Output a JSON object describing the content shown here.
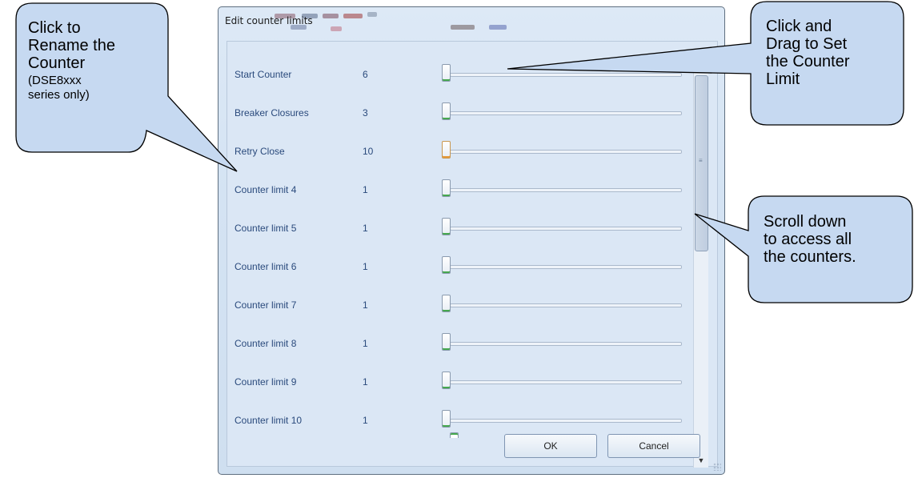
{
  "dialog": {
    "title": "Edit counter limits",
    "rows": [
      {
        "label": "Start Counter",
        "value": "6"
      },
      {
        "label": "Breaker Closures",
        "value": "3"
      },
      {
        "label": "Retry Close",
        "value": "10"
      },
      {
        "label": "Counter limit 4",
        "value": "1"
      },
      {
        "label": "Counter limit 5",
        "value": "1"
      },
      {
        "label": "Counter limit 6",
        "value": "1"
      },
      {
        "label": "Counter limit 7",
        "value": "1"
      },
      {
        "label": "Counter limit 8",
        "value": "1"
      },
      {
        "label": "Counter limit 9",
        "value": "1"
      },
      {
        "label": "Counter limit 10",
        "value": "1"
      }
    ],
    "ok_label": "OK",
    "cancel_label": "Cancel"
  },
  "callouts": {
    "rename": {
      "line1": "Click to",
      "line2": "Rename the",
      "line3": "Counter",
      "line4": "(DSE8xxx",
      "line5": "series only)"
    },
    "drag": {
      "line1": "Click and",
      "line2": "Drag to Set",
      "line3": "the Counter",
      "line4": "Limit"
    },
    "scroll": {
      "line1": "Scroll down",
      "line2": "to access all",
      "line3": "the  counters."
    }
  },
  "colors": {
    "accent": "#2a4a7c",
    "callout_fill": "#c6d9f1",
    "slider_tick": "#45a84e",
    "slider_hot": "#e59a3a"
  }
}
